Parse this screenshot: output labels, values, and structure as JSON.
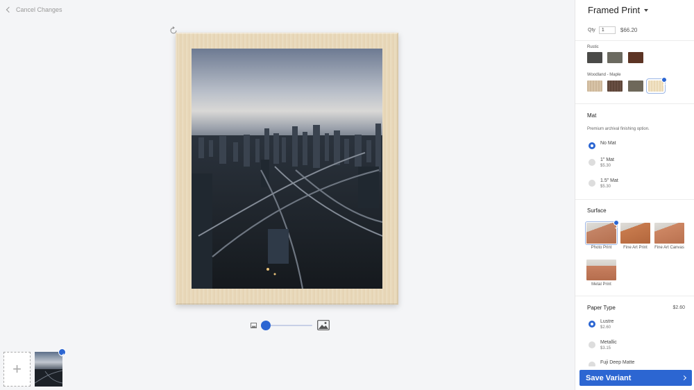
{
  "canvas": {
    "cancel_label": "Cancel Changes",
    "add_label": "+"
  },
  "panel": {
    "title": "Framed Print",
    "qty_label": "Qty",
    "qty_value": "1",
    "price": "$66.20",
    "frames": {
      "rustic_label": "Rustic",
      "rustic_colors": [
        "#4a4a48",
        "#6b6a60",
        "#5c3424"
      ],
      "woodland_label": "Woodland - Maple",
      "woodland_colors": [
        "#cdb79a",
        "#5d4538",
        "#6e685a",
        "#ead8b4"
      ]
    },
    "mat": {
      "title": "Mat",
      "desc": "Premium archival finishing option.",
      "options": [
        {
          "label": "No Mat",
          "price": ""
        },
        {
          "label": "1\" Mat",
          "price": "$5.30"
        },
        {
          "label": "1.5\" Mat",
          "price": "$5.30"
        }
      ]
    },
    "surface": {
      "title": "Surface",
      "options": [
        {
          "label": "Photo Print",
          "color": "#c48466"
        },
        {
          "label": "Fine Art Print",
          "color": "#c77a4d"
        },
        {
          "label": "Fine Art Canvas",
          "color": "#cd8663"
        },
        {
          "label": "Metal Print",
          "color": "#c88060"
        }
      ]
    },
    "paper": {
      "title": "Paper Type",
      "price": "$2.60",
      "options": [
        {
          "label": "Lustre",
          "price": "$2.60"
        },
        {
          "label": "Metallic",
          "price": "$3.15"
        },
        {
          "label": "Fuji Deep Matte",
          "price": ""
        }
      ]
    },
    "save_label": "Save Variant"
  },
  "colors": {
    "accent": "#2c66d2"
  }
}
